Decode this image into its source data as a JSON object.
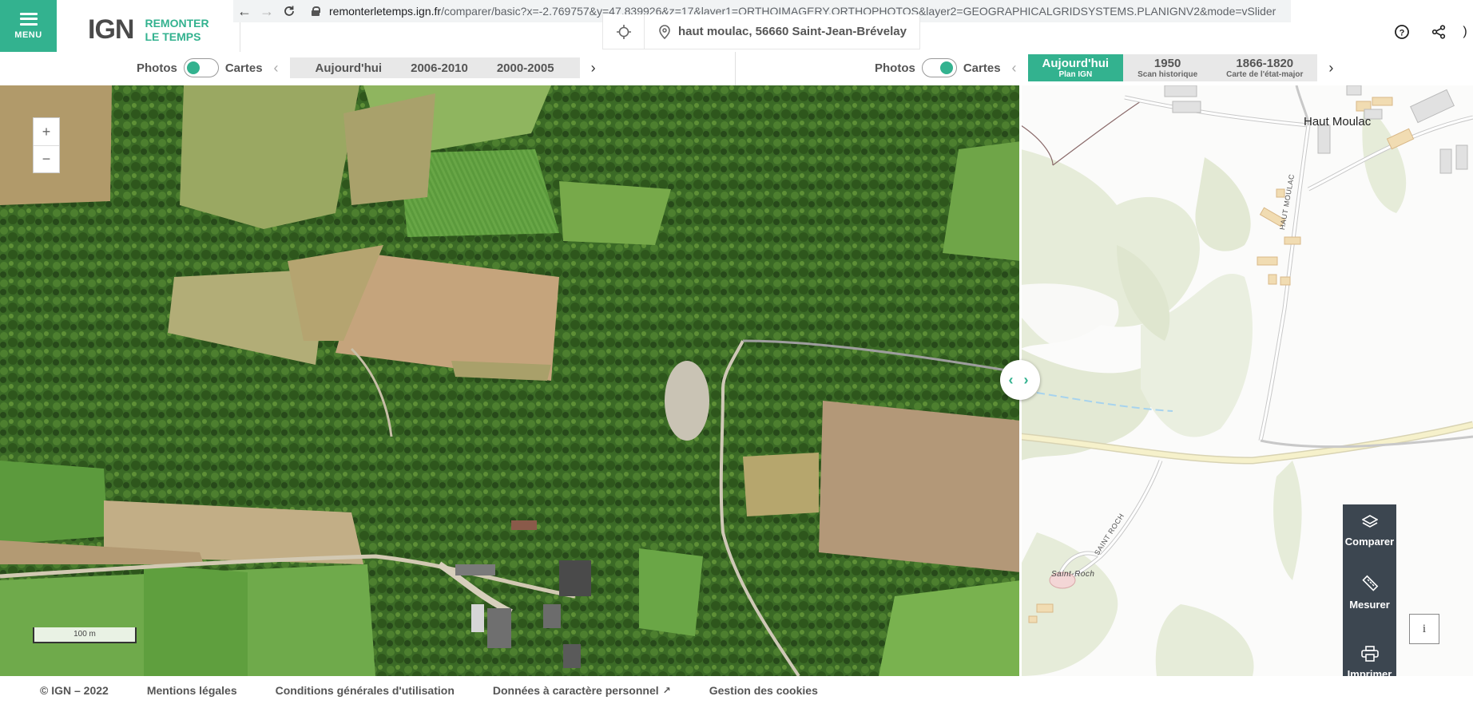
{
  "browser": {
    "url_host": "remonterletemps.ign.fr",
    "url_path": "/comparer/basic?x=-2.769757&y=47.839926&z=17&layer1=ORTHOIMAGERY.ORTHOPHOTOS&layer2=GEOGRAPHICALGRIDSYSTEMS.PLANIGNV2&mode=vSlider"
  },
  "header": {
    "menu_label": "MENU",
    "logo_mark": "IGN",
    "logo_line1": "REMONTER",
    "logo_line2": "LE TEMPS",
    "search_value": "haut moulac, 56660 Saint-Jean-Brévelay",
    "more_symbol": ")"
  },
  "left_selector": {
    "photos_label": "Photos",
    "cartes_label": "Cartes",
    "toggle_state": "photos",
    "prev_symbol": "‹",
    "next_symbol": "›",
    "tabs": [
      {
        "label": "Aujourd'hui"
      },
      {
        "label": "2006-2010"
      },
      {
        "label": "2000-2005"
      }
    ]
  },
  "right_selector": {
    "photos_label": "Photos",
    "cartes_label": "Cartes",
    "toggle_state": "cartes",
    "prev_symbol": "‹",
    "next_symbol": "›",
    "tabs": [
      {
        "label": "Aujourd'hui",
        "sub": "Plan IGN",
        "active": true
      },
      {
        "label": "1950",
        "sub": "Scan historique",
        "active": false
      },
      {
        "label": "1866-1820",
        "sub": "Carte de l'état-major",
        "active": false
      }
    ]
  },
  "map": {
    "zoom_in": "+",
    "zoom_out": "−",
    "scale_label": "100 m",
    "slider_symbol": "‹ ›",
    "place_label": "Haut Moulac",
    "road_label_1": "HAUT MOULAC",
    "road_label_2": "SAINT ROCH",
    "poi_label": "Saint-Roch"
  },
  "tools": {
    "compare": "Comparer",
    "measure": "Mesurer",
    "print": "Imprimer",
    "info": "i"
  },
  "footer": {
    "copyright": "© IGN – 2022",
    "legal": "Mentions légales",
    "cgu": "Conditions générales d'utilisation",
    "privacy": "Données à caractère personnel",
    "cookies": "Gestion des cookies"
  },
  "colors": {
    "accent": "#33b28f",
    "tool_panel": "#3c4650"
  }
}
